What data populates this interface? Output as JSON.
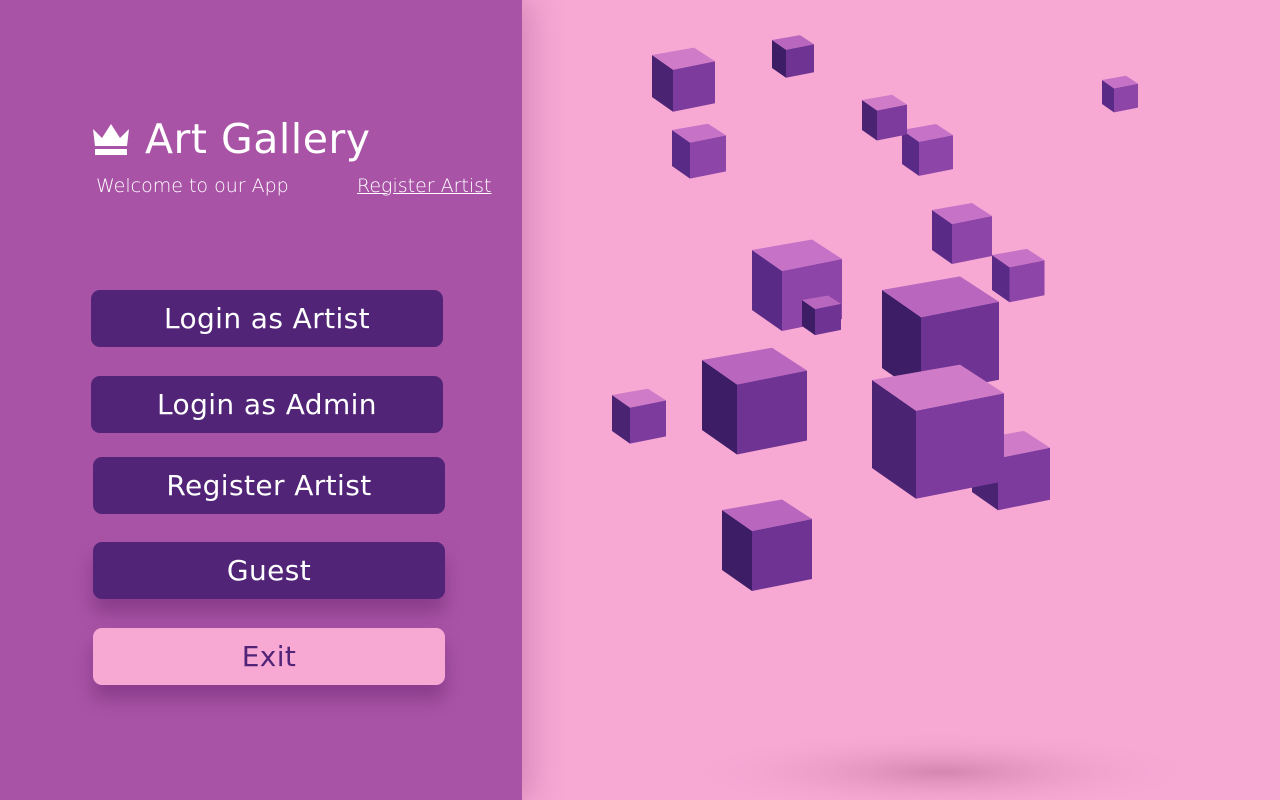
{
  "app": {
    "title": "Art Gallery",
    "subtitle": "Welcome to our App",
    "register_link": "Register Artist"
  },
  "icons": {
    "logo": "crown-icon"
  },
  "buttons": {
    "login_artist": "Login as Artist",
    "login_admin": "Login as Admin",
    "register_artist": "Register Artist",
    "guest": "Guest",
    "exit": "Exit"
  },
  "colors": {
    "sidebar": "#a953a6",
    "background": "#f7a8d3",
    "button": "#512478",
    "exit_button": "#f7a8d3",
    "exit_text": "#512478"
  }
}
